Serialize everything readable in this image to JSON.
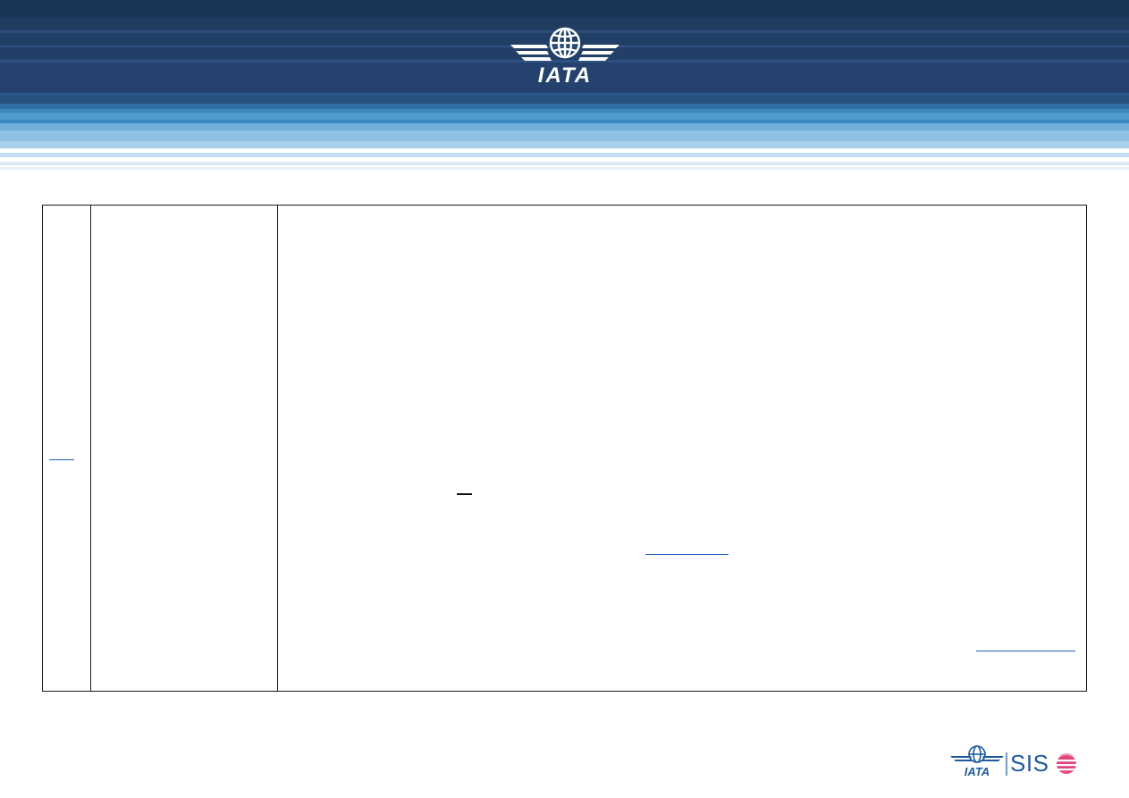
{
  "header": {
    "logo_name": "IATA",
    "colors": {
      "dark_navy": "#1b3556",
      "navy": "#24406a",
      "mid_blue": "#2f6fa6",
      "light_blue": "#8ec1e3",
      "pale_blue": "#dceaf6"
    }
  },
  "table": {
    "columns": 3,
    "border_color": "#1a1a1a",
    "link_color": "#1f5fbf"
  },
  "footer": {
    "logo_name": "IATA",
    "product_label": "SIS",
    "colors": {
      "brand_blue": "#1f5a9e",
      "accent_pink": "#e4457e"
    }
  }
}
